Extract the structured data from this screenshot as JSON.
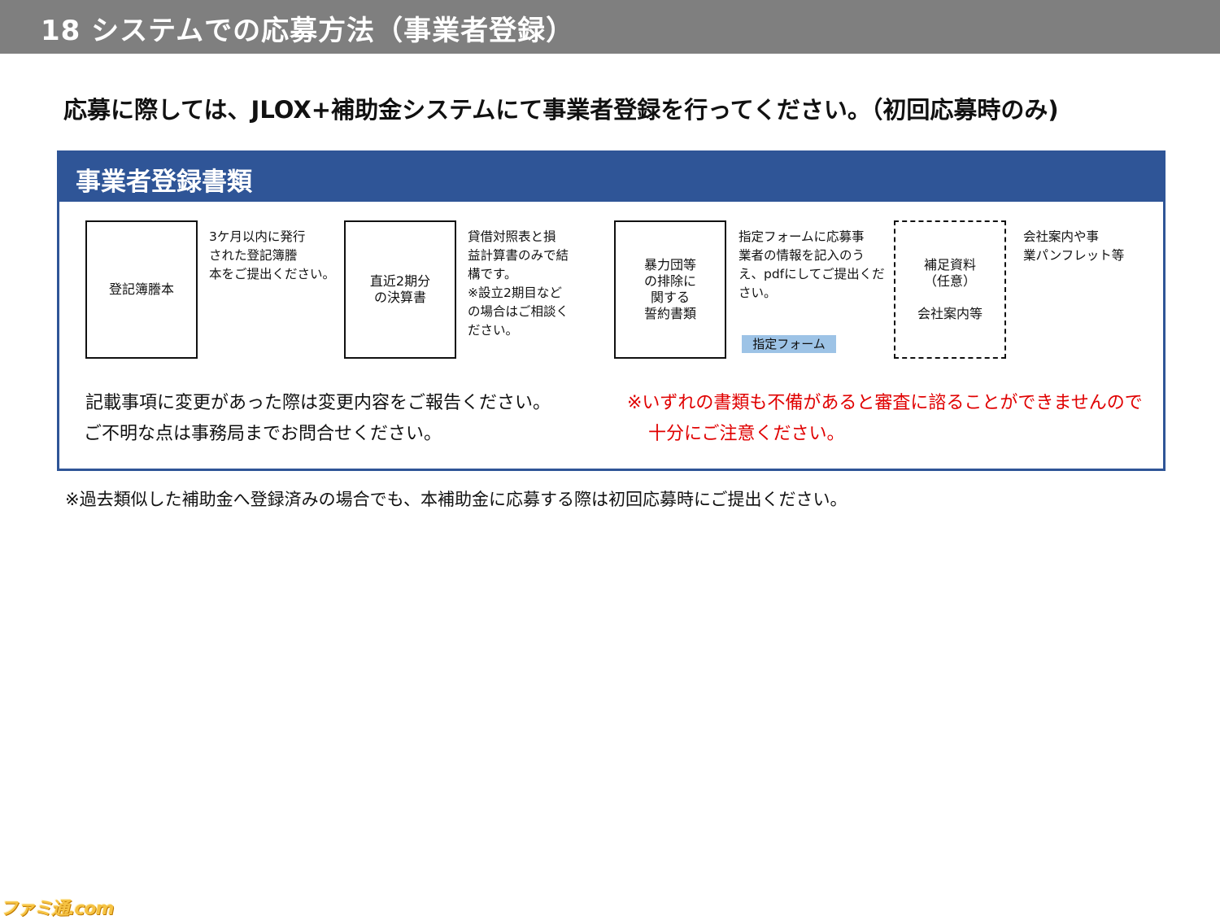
{
  "header": {
    "title": "18  システムでの応募方法（事業者登録）"
  },
  "headline": "応募に際しては、JLOX+補助金システムにて事業者登録を行ってください。（初回応募時のみ)",
  "panel": {
    "title": "事業者登録書類",
    "documents": [
      {
        "box_label": "登記簿謄本",
        "description": "3ケ月以内に発行\nされた登記簿謄\n本をご提出ください。"
      },
      {
        "box_label": "直近2期分\nの決算書",
        "description": "貸借対照表と損\n益計算書のみで結\n構です。\n※設立2期目など\nの場合はご相談く\nださい。"
      },
      {
        "box_label": "暴力団等\nの排除に\n関する\n誓約書類",
        "description": "指定フォームに応募事\n業者の情報を記入のう\nえ、pdfにしてご提出くだ\nさい。",
        "form_button": "指定フォーム"
      },
      {
        "box_label": "補足資料\n（任意）\n\n会社案内等",
        "description": "会社案内や事\n業パンフレット等"
      }
    ],
    "notice_lines": [
      "記載事項に変更があった際は変更内容をご報告ください。",
      "ご不明な点は事務局までお問合せください。"
    ],
    "warning_lines": [
      "※いずれの書類も不備があると審査に諮ることができませんので",
      "十分にご注意ください。"
    ]
  },
  "footnote": "※過去類似した補助金へ登録済みの場合でも、本補助金に応募する際は初回応募時にご提出ください。",
  "watermark": "ファミ通.com",
  "colors": {
    "title_bar": "#7f7f7f",
    "panel_accent": "#2f5597",
    "warning": "#e00000",
    "form_chip": "#9dc3e6"
  }
}
